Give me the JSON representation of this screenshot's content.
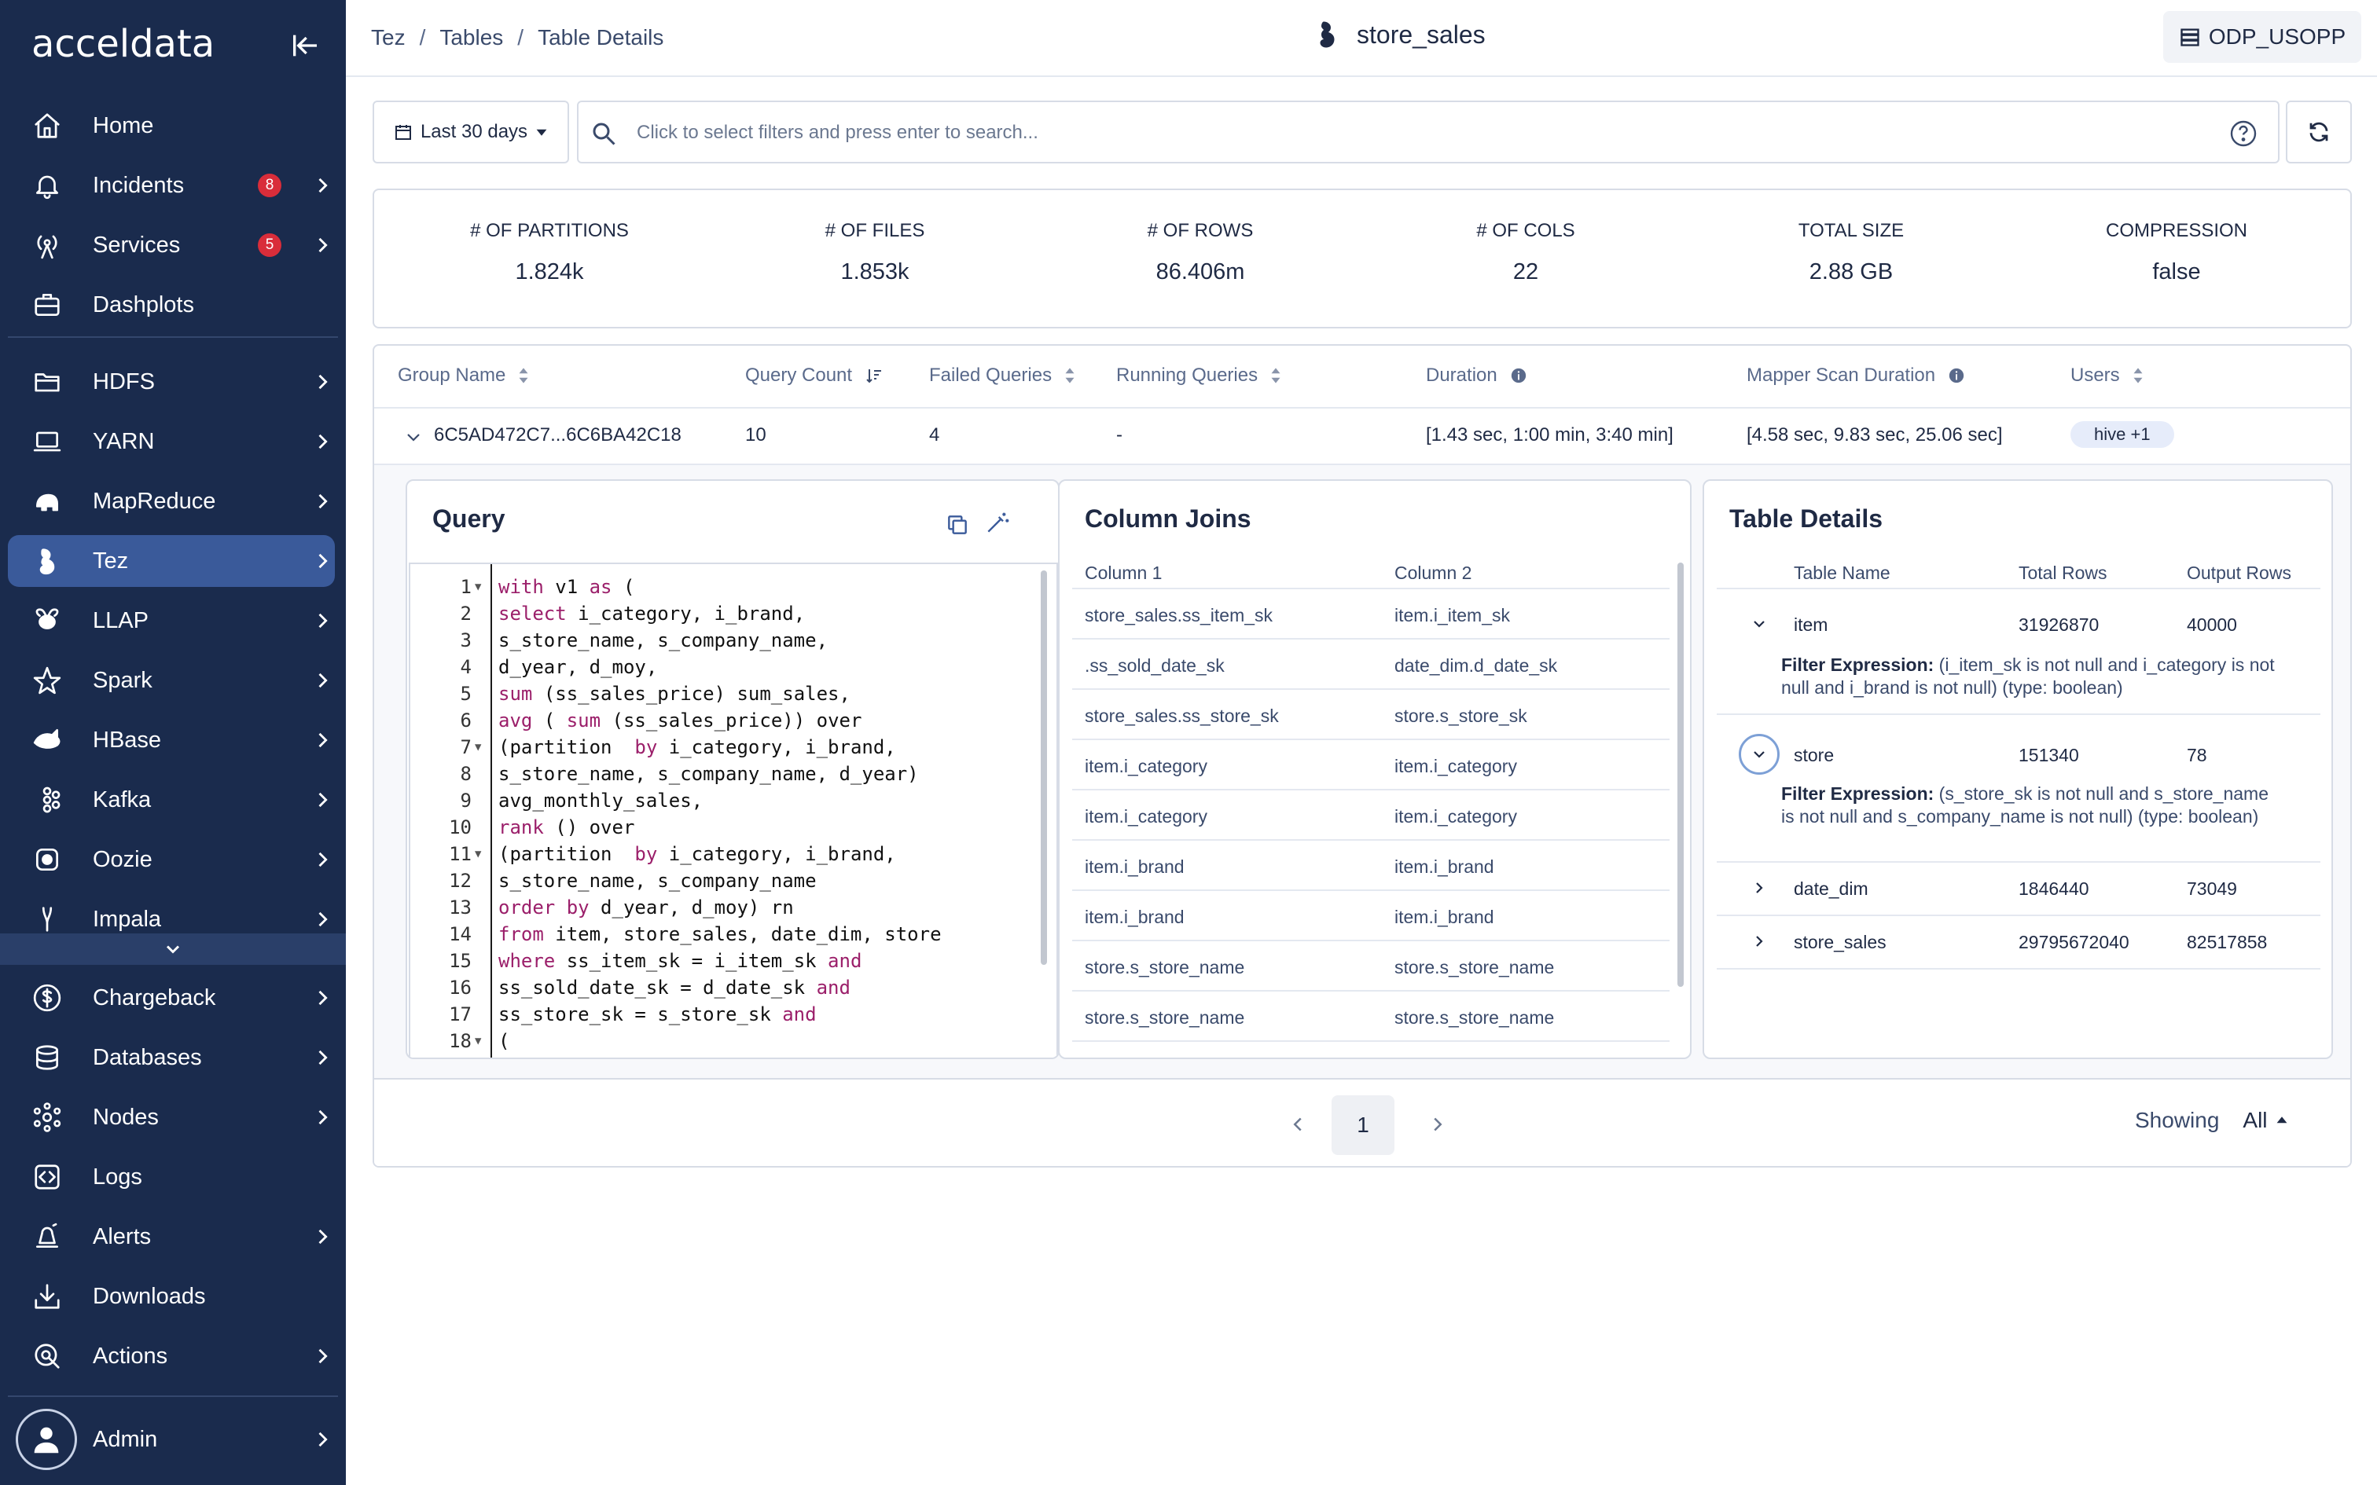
{
  "app": {
    "logo": "acceldata"
  },
  "sidebar": {
    "items": [
      {
        "label": "Home",
        "icon": "home-icon"
      },
      {
        "label": "Incidents",
        "icon": "bell-icon",
        "badge": "8"
      },
      {
        "label": "Services",
        "icon": "antenna-icon",
        "badge": "5"
      },
      {
        "label": "Dashplots",
        "icon": "briefcase-icon"
      },
      {
        "label": "HDFS",
        "icon": "folder-icon"
      },
      {
        "label": "YARN",
        "icon": "laptop-icon"
      },
      {
        "label": "MapReduce",
        "icon": "elephant-icon"
      },
      {
        "label": "Tez",
        "icon": "tez-icon"
      },
      {
        "label": "LLAP",
        "icon": "bee-icon"
      },
      {
        "label": "Spark",
        "icon": "spark-icon"
      },
      {
        "label": "HBase",
        "icon": "orca-icon"
      },
      {
        "label": "Kafka",
        "icon": "kafka-icon"
      },
      {
        "label": "Oozie",
        "icon": "oozie-icon"
      },
      {
        "label": "Impala",
        "icon": "impala-icon"
      },
      {
        "label": "Chargeback",
        "icon": "dollar-icon"
      },
      {
        "label": "Databases",
        "icon": "database-icon"
      },
      {
        "label": "Nodes",
        "icon": "nodes-icon"
      },
      {
        "label": "Logs",
        "icon": "code-icon"
      },
      {
        "label": "Alerts",
        "icon": "alert-bell-icon"
      },
      {
        "label": "Downloads",
        "icon": "download-icon"
      },
      {
        "label": "Actions",
        "icon": "actions-icon"
      },
      {
        "label": "Admin",
        "icon": "user-icon"
      }
    ]
  },
  "header": {
    "breadcrumb": [
      "Tez",
      "Tables",
      "Table Details"
    ],
    "title": "store_sales",
    "cluster": "ODP_USOPP"
  },
  "filters": {
    "date_range": "Last 30 days",
    "search_placeholder": "Click to select filters and press enter to search..."
  },
  "stats": [
    {
      "label": "# OF PARTITIONS",
      "value": "1.824k"
    },
    {
      "label": "# OF FILES",
      "value": "1.853k"
    },
    {
      "label": "# OF ROWS",
      "value": "86.406m"
    },
    {
      "label": "# OF COLS",
      "value": "22"
    },
    {
      "label": "TOTAL SIZE",
      "value": "2.88 GB"
    },
    {
      "label": "COMPRESSION",
      "value": "false"
    }
  ],
  "groups": {
    "headers": [
      "Group Name",
      "Query Count",
      "Failed Queries",
      "Running Queries",
      "Duration",
      "Mapper Scan Duration",
      "Users"
    ],
    "row": {
      "group_name": "6C5AD472C7...6C6BA42C18",
      "query_count": "10",
      "failed_queries": "4",
      "running_queries": "-",
      "duration": "[1.43 sec, 1:00 min, 3:40 min]",
      "mapper_scan_duration": "[4.58 sec, 9.83 sec, 25.06 sec]",
      "users": "hive +1"
    }
  },
  "query": {
    "title": "Query",
    "lines": [
      {
        "n": "1",
        "fold": true,
        "parts": [
          [
            "kw",
            "with"
          ],
          [
            "",
            "v1"
          ],
          [
            "kw",
            "as"
          ],
          [
            "",
            "("
          ]
        ]
      },
      {
        "n": "2",
        "parts": [
          [
            "kw",
            "select"
          ],
          [
            "",
            "i_category, i_brand,"
          ]
        ]
      },
      {
        "n": "3",
        "parts": [
          [
            "",
            "s_store_name, s_company_name,"
          ]
        ]
      },
      {
        "n": "4",
        "parts": [
          [
            "",
            "d_year, d_moy,"
          ]
        ]
      },
      {
        "n": "5",
        "parts": [
          [
            "kw",
            "sum"
          ],
          [
            "",
            "(ss_sales_price) sum_sales,"
          ]
        ]
      },
      {
        "n": "6",
        "parts": [
          [
            "kw",
            "avg"
          ],
          [
            "",
            "("
          ],
          [
            "kw",
            "sum"
          ],
          [
            "",
            "(ss_sales_price)) over"
          ]
        ]
      },
      {
        "n": "7",
        "fold": true,
        "parts": [
          [
            "",
            "(partition "
          ],
          [
            "kw",
            "by"
          ],
          [
            "",
            "i_category, i_brand,"
          ]
        ]
      },
      {
        "n": "8",
        "parts": [
          [
            "",
            "s_store_name, s_company_name, d_year)"
          ]
        ]
      },
      {
        "n": "9",
        "parts": [
          [
            "",
            "avg_monthly_sales,"
          ]
        ]
      },
      {
        "n": "10",
        "parts": [
          [
            "kw",
            "rank"
          ],
          [
            "",
            "() over"
          ]
        ]
      },
      {
        "n": "11",
        "fold": true,
        "parts": [
          [
            "",
            "(partition "
          ],
          [
            "kw",
            "by"
          ],
          [
            "",
            "i_category, i_brand,"
          ]
        ]
      },
      {
        "n": "12",
        "parts": [
          [
            "",
            "s_store_name, s_company_name"
          ]
        ]
      },
      {
        "n": "13",
        "parts": [
          [
            "kw",
            "order by"
          ],
          [
            "",
            "d_year, d_moy) rn"
          ]
        ]
      },
      {
        "n": "14",
        "parts": [
          [
            "kw",
            "from"
          ],
          [
            "",
            "item, store_sales, date_dim, store"
          ]
        ]
      },
      {
        "n": "15",
        "parts": [
          [
            "kw",
            "where"
          ],
          [
            "",
            "ss_item_sk = i_item_sk"
          ],
          [
            "kw",
            "and"
          ]
        ]
      },
      {
        "n": "16",
        "parts": [
          [
            "",
            "ss_sold_date_sk = d_date_sk"
          ],
          [
            "kw",
            "and"
          ]
        ]
      },
      {
        "n": "17",
        "parts": [
          [
            "",
            "ss_store_sk = s_store_sk"
          ],
          [
            "kw",
            "and"
          ]
        ]
      },
      {
        "n": "18",
        "fold": true,
        "parts": [
          [
            "",
            "("
          ]
        ]
      }
    ]
  },
  "joins": {
    "title": "Column Joins",
    "headers": [
      "Column 1",
      "Column 2"
    ],
    "rows": [
      [
        "store_sales.ss_item_sk",
        "item.i_item_sk"
      ],
      [
        ".ss_sold_date_sk",
        "date_dim.d_date_sk"
      ],
      [
        "store_sales.ss_store_sk",
        "store.s_store_sk"
      ],
      [
        "item.i_category",
        "item.i_category"
      ],
      [
        "item.i_category",
        "item.i_category"
      ],
      [
        "item.i_brand",
        "item.i_brand"
      ],
      [
        "item.i_brand",
        "item.i_brand"
      ],
      [
        "store.s_store_name",
        "store.s_store_name"
      ],
      [
        "store.s_store_name",
        "store.s_store_name"
      ]
    ]
  },
  "table_details": {
    "title": "Table Details",
    "headers": [
      "Table Name",
      "Total Rows",
      "Output Rows"
    ],
    "filter_label": "Filter Expression:",
    "rows": [
      {
        "name": "item",
        "total": "31926870",
        "output": "40000",
        "expanded": true,
        "filter": "(i_item_sk is not null and i_category is not null and i_brand is not null) (type: boolean)"
      },
      {
        "name": "store",
        "total": "151340",
        "output": "78",
        "expanded": true,
        "filter": "(s_store_sk is not null and s_store_name is not null and s_company_name is not null) (type: boolean)"
      },
      {
        "name": "date_dim",
        "total": "1846440",
        "output": "73049",
        "expanded": false
      },
      {
        "name": "store_sales",
        "total": "29795672040",
        "output": "82517858",
        "expanded": false
      }
    ]
  },
  "pagination": {
    "current": "1",
    "showing_label": "Showing",
    "showing_value": "All"
  }
}
